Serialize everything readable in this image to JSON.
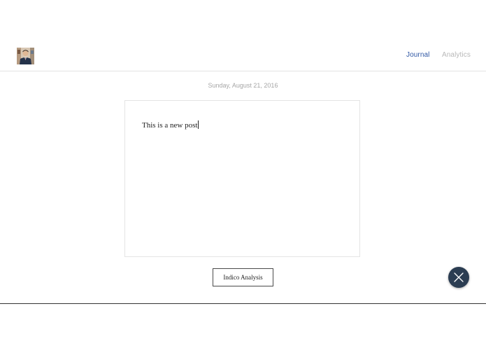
{
  "header": {
    "nav": {
      "journal_label": "Journal",
      "analytics_label": "Analytics",
      "active": "Journal"
    }
  },
  "main": {
    "date": "Sunday, August 21, 2016",
    "editor": {
      "content": "This is a new post"
    },
    "analysis_button_label": "Indico Analysis"
  },
  "icons": {
    "avatar": "user-avatar",
    "close": "close-icon"
  },
  "colors": {
    "nav_active": "#2f57a4",
    "nav_inactive": "#b8b8b8",
    "fab_background": "#2b3d52",
    "date_text": "#a6a6a6"
  }
}
